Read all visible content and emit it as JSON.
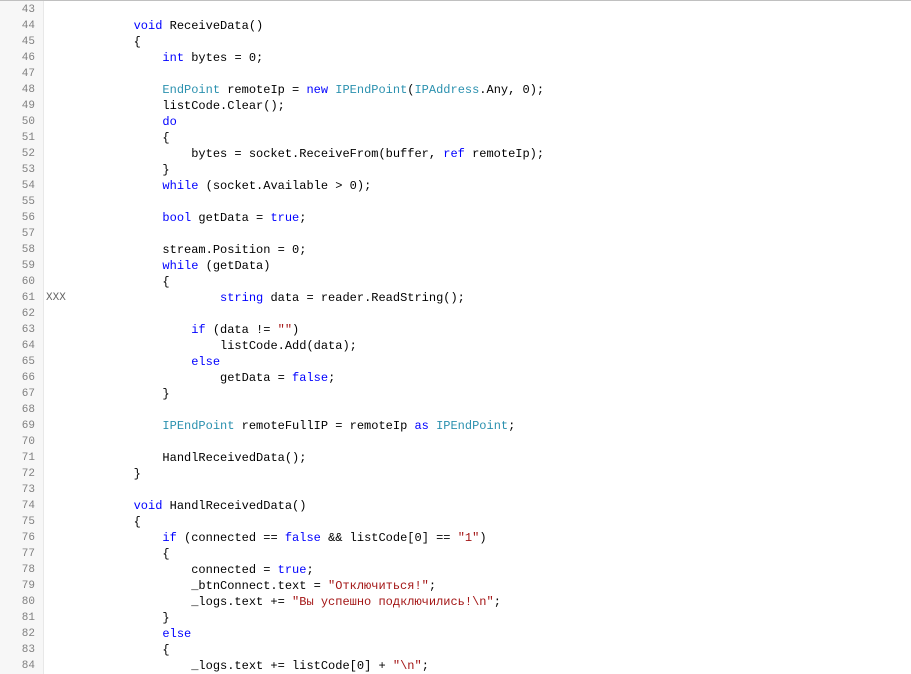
{
  "lineNumbers": [
    43,
    44,
    45,
    46,
    47,
    48,
    49,
    50,
    51,
    52,
    53,
    54,
    55,
    56,
    57,
    58,
    59,
    60,
    61,
    62,
    63,
    64,
    65,
    66,
    67,
    68,
    69,
    70,
    71,
    72,
    73,
    74,
    75,
    76,
    77,
    78,
    79,
    80,
    81,
    82,
    83,
    84
  ],
  "marker": {
    "line": 61,
    "text": "XXX"
  },
  "code": [
    {
      "indent": 0,
      "tokens": []
    },
    {
      "indent": 2,
      "tokens": [
        {
          "t": "k",
          "v": "void"
        },
        {
          "t": "n",
          "v": " ReceiveData()"
        }
      ]
    },
    {
      "indent": 2,
      "tokens": [
        {
          "t": "p",
          "v": "{"
        }
      ]
    },
    {
      "indent": 3,
      "tokens": [
        {
          "t": "k",
          "v": "int"
        },
        {
          "t": "n",
          "v": " bytes = "
        },
        {
          "t": "num",
          "v": "0"
        },
        {
          "t": "p",
          "v": ";"
        }
      ]
    },
    {
      "indent": 0,
      "tokens": []
    },
    {
      "indent": 3,
      "tokens": [
        {
          "t": "t",
          "v": "EndPoint"
        },
        {
          "t": "n",
          "v": " remoteIp = "
        },
        {
          "t": "k",
          "v": "new"
        },
        {
          "t": "n",
          "v": " "
        },
        {
          "t": "t",
          "v": "IPEndPoint"
        },
        {
          "t": "p",
          "v": "("
        },
        {
          "t": "t",
          "v": "IPAddress"
        },
        {
          "t": "n",
          "v": ".Any, "
        },
        {
          "t": "num",
          "v": "0"
        },
        {
          "t": "p",
          "v": ");"
        }
      ]
    },
    {
      "indent": 3,
      "tokens": [
        {
          "t": "n",
          "v": "listCode.Clear();"
        }
      ]
    },
    {
      "indent": 3,
      "tokens": [
        {
          "t": "k",
          "v": "do"
        }
      ]
    },
    {
      "indent": 3,
      "tokens": [
        {
          "t": "p",
          "v": "{"
        }
      ]
    },
    {
      "indent": 4,
      "tokens": [
        {
          "t": "n",
          "v": "bytes = socket.ReceiveFrom(buffer, "
        },
        {
          "t": "k",
          "v": "ref"
        },
        {
          "t": "n",
          "v": " remoteIp);"
        }
      ]
    },
    {
      "indent": 3,
      "tokens": [
        {
          "t": "p",
          "v": "}"
        }
      ]
    },
    {
      "indent": 3,
      "tokens": [
        {
          "t": "k",
          "v": "while"
        },
        {
          "t": "n",
          "v": " (socket.Available > "
        },
        {
          "t": "num",
          "v": "0"
        },
        {
          "t": "p",
          "v": ");"
        }
      ]
    },
    {
      "indent": 0,
      "tokens": []
    },
    {
      "indent": 3,
      "tokens": [
        {
          "t": "k",
          "v": "bool"
        },
        {
          "t": "n",
          "v": " getData = "
        },
        {
          "t": "k",
          "v": "true"
        },
        {
          "t": "p",
          "v": ";"
        }
      ]
    },
    {
      "indent": 0,
      "tokens": []
    },
    {
      "indent": 3,
      "tokens": [
        {
          "t": "n",
          "v": "stream.Position = "
        },
        {
          "t": "num",
          "v": "0"
        },
        {
          "t": "p",
          "v": ";"
        }
      ]
    },
    {
      "indent": 3,
      "tokens": [
        {
          "t": "k",
          "v": "while"
        },
        {
          "t": "n",
          "v": " (getData)"
        }
      ]
    },
    {
      "indent": 3,
      "tokens": [
        {
          "t": "p",
          "v": "{"
        }
      ]
    },
    {
      "indent": 5,
      "tokens": [
        {
          "t": "k",
          "v": "string"
        },
        {
          "t": "n",
          "v": " data = reader.ReadString();"
        }
      ]
    },
    {
      "indent": 0,
      "tokens": []
    },
    {
      "indent": 4,
      "tokens": [
        {
          "t": "k",
          "v": "if"
        },
        {
          "t": "n",
          "v": " (data != "
        },
        {
          "t": "s",
          "v": "\"\""
        },
        {
          "t": "p",
          "v": ")"
        }
      ]
    },
    {
      "indent": 5,
      "tokens": [
        {
          "t": "n",
          "v": "listCode.Add(data);"
        }
      ]
    },
    {
      "indent": 4,
      "tokens": [
        {
          "t": "k",
          "v": "else"
        }
      ]
    },
    {
      "indent": 5,
      "tokens": [
        {
          "t": "n",
          "v": "getData = "
        },
        {
          "t": "k",
          "v": "false"
        },
        {
          "t": "p",
          "v": ";"
        }
      ]
    },
    {
      "indent": 3,
      "tokens": [
        {
          "t": "p",
          "v": "}"
        }
      ]
    },
    {
      "indent": 0,
      "tokens": []
    },
    {
      "indent": 3,
      "tokens": [
        {
          "t": "t",
          "v": "IPEndPoint"
        },
        {
          "t": "n",
          "v": " remoteFullIP = remoteIp "
        },
        {
          "t": "k",
          "v": "as"
        },
        {
          "t": "n",
          "v": " "
        },
        {
          "t": "t",
          "v": "IPEndPoint"
        },
        {
          "t": "p",
          "v": ";"
        }
      ]
    },
    {
      "indent": 0,
      "tokens": []
    },
    {
      "indent": 3,
      "tokens": [
        {
          "t": "n",
          "v": "HandlReceivedData();"
        }
      ]
    },
    {
      "indent": 2,
      "tokens": [
        {
          "t": "p",
          "v": "}"
        }
      ]
    },
    {
      "indent": 0,
      "tokens": []
    },
    {
      "indent": 2,
      "tokens": [
        {
          "t": "k",
          "v": "void"
        },
        {
          "t": "n",
          "v": " HandlReceivedData()"
        }
      ]
    },
    {
      "indent": 2,
      "tokens": [
        {
          "t": "p",
          "v": "{"
        }
      ]
    },
    {
      "indent": 3,
      "tokens": [
        {
          "t": "k",
          "v": "if"
        },
        {
          "t": "n",
          "v": " (connected == "
        },
        {
          "t": "k",
          "v": "false"
        },
        {
          "t": "n",
          "v": " && listCode["
        },
        {
          "t": "num",
          "v": "0"
        },
        {
          "t": "n",
          "v": "] == "
        },
        {
          "t": "s",
          "v": "\"1\""
        },
        {
          "t": "p",
          "v": ")"
        }
      ]
    },
    {
      "indent": 3,
      "tokens": [
        {
          "t": "p",
          "v": "{"
        }
      ]
    },
    {
      "indent": 4,
      "tokens": [
        {
          "t": "n",
          "v": "connected = "
        },
        {
          "t": "k",
          "v": "true"
        },
        {
          "t": "p",
          "v": ";"
        }
      ]
    },
    {
      "indent": 4,
      "tokens": [
        {
          "t": "n",
          "v": "_btnConnect.text = "
        },
        {
          "t": "s",
          "v": "\"Отключиться!\""
        },
        {
          "t": "p",
          "v": ";"
        }
      ]
    },
    {
      "indent": 4,
      "tokens": [
        {
          "t": "n",
          "v": "_logs.text += "
        },
        {
          "t": "s",
          "v": "\"Вы успешно подключились!\\n\""
        },
        {
          "t": "p",
          "v": ";"
        }
      ]
    },
    {
      "indent": 3,
      "tokens": [
        {
          "t": "p",
          "v": "}"
        }
      ]
    },
    {
      "indent": 3,
      "tokens": [
        {
          "t": "k",
          "v": "else"
        }
      ]
    },
    {
      "indent": 3,
      "tokens": [
        {
          "t": "p",
          "v": "{"
        }
      ]
    },
    {
      "indent": 4,
      "tokens": [
        {
          "t": "n",
          "v": "_logs.text += listCode["
        },
        {
          "t": "num",
          "v": "0"
        },
        {
          "t": "n",
          "v": "] + "
        },
        {
          "t": "s",
          "v": "\"\\n\""
        },
        {
          "t": "p",
          "v": ";"
        }
      ]
    }
  ]
}
